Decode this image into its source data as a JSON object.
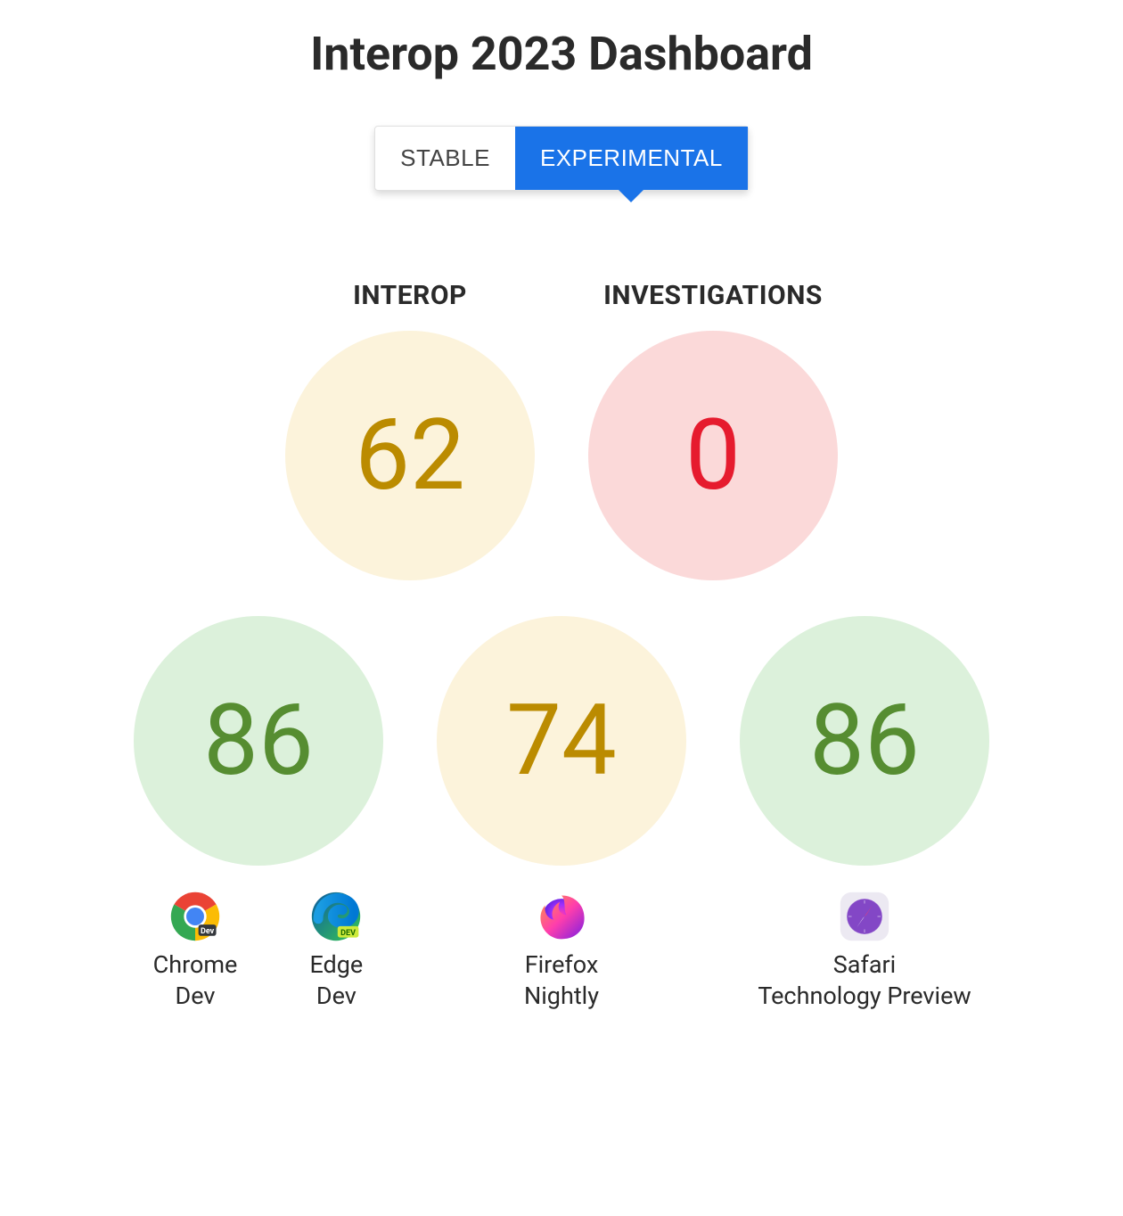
{
  "title": "Interop 2023 Dashboard",
  "tabs": {
    "stable": "STABLE",
    "experimental": "EXPERIMENTAL"
  },
  "topScores": {
    "interop": {
      "label": "INTEROP",
      "value": "62"
    },
    "investigations": {
      "label": "INVESTIGATIONS",
      "value": "0"
    }
  },
  "browserScores": {
    "chromeEdge": {
      "value": "86",
      "browsers": [
        {
          "name_line1": "Chrome",
          "name_line2": "Dev"
        },
        {
          "name_line1": "Edge",
          "name_line2": "Dev"
        }
      ]
    },
    "firefox": {
      "value": "74",
      "browsers": [
        {
          "name_line1": "Firefox",
          "name_line2": "Nightly"
        }
      ]
    },
    "safari": {
      "value": "86",
      "browsers": [
        {
          "name_line1": "Safari",
          "name_line2": "Technology Preview"
        }
      ]
    }
  }
}
